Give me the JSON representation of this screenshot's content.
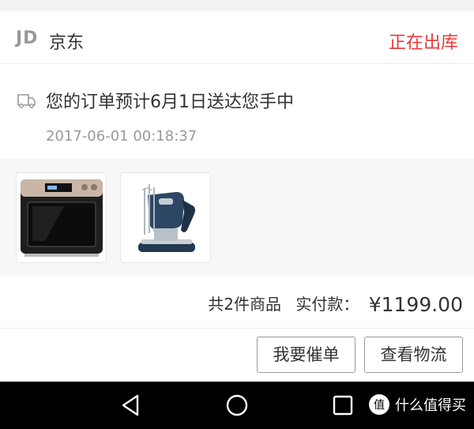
{
  "order": {
    "shop_logo": "JD",
    "shop_name": "京东",
    "status": "正在出库",
    "status_color": "#e4393c"
  },
  "tracking": {
    "icon": "truck-icon",
    "message": "您的订单预计6月1日送达您手中",
    "time": "2017-06-01 00:18:37"
  },
  "products": [
    {
      "name": "oven-product",
      "icon": "steam-oven-image"
    },
    {
      "name": "mixer-product",
      "icon": "hand-mixer-image"
    }
  ],
  "summary": {
    "count_text": "共2件商品",
    "paid_label": "实付款：",
    "price": "¥1199.00"
  },
  "actions": {
    "urge_label": "我要催单",
    "logistics_label": "查看物流"
  },
  "navbar": {
    "back": "back-triangle-icon",
    "home": "home-circle-icon",
    "recents": "recents-square-icon"
  },
  "watermark": {
    "logo_glyph": "值",
    "text": "什么值得买"
  }
}
